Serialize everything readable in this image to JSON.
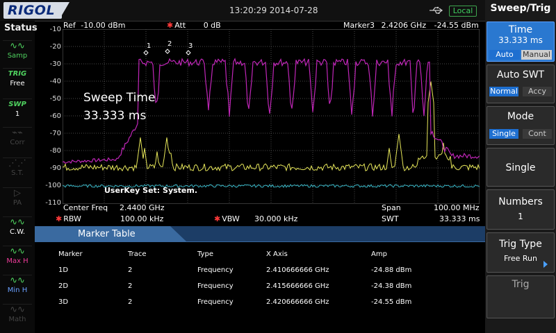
{
  "header": {
    "logo": "RIGOL",
    "datetime": "13:20:29 2014-07-28",
    "local_badge": "Local"
  },
  "status": {
    "title": "Status",
    "items": [
      {
        "icon": "wave-icon",
        "label": "Samp"
      },
      {
        "icon_text": "TRIG",
        "label": "Free"
      },
      {
        "icon_text": "SWP",
        "label": "1"
      },
      {
        "icon": "corr-icon",
        "label": "Corr"
      },
      {
        "icon": "st-icon",
        "label": "S.T."
      },
      {
        "icon": "pa-icon",
        "label": "PA"
      },
      {
        "icon": "wave-icon",
        "label": "C.W."
      },
      {
        "icon": "wave-icon",
        "label": "Max H"
      },
      {
        "icon": "wave-icon",
        "label": "Min H"
      },
      {
        "icon": "wave-icon",
        "label": "Math"
      }
    ]
  },
  "plot_header": {
    "ref_label": "Ref",
    "ref_value": "-10.00 dBm",
    "att_label": "Att",
    "att_value": "0 dB",
    "marker_label": "Marker3",
    "marker_freq": "2.4206 GHz",
    "marker_amp": "-24.55 dBm"
  },
  "y_axis": [
    "-10",
    "-20",
    "-30",
    "-40",
    "-50",
    "-60",
    "-70",
    "-80",
    "-90",
    "-100",
    "-110"
  ],
  "markers_on_plot": [
    "1",
    "2",
    "3"
  ],
  "overlay": {
    "sweep_time_label": "Sweep Time",
    "sweep_time_value": "33.333 ms",
    "userkey_text": "UserKey Set:  System."
  },
  "params": {
    "center_freq_label": "Center Freq",
    "center_freq_value": "2.4400 GHz",
    "span_label": "Span",
    "span_value": "100.00 MHz",
    "rbw_label": "RBW",
    "rbw_value": "100.00 kHz",
    "vbw_label": "VBW",
    "vbw_value": "30.000 kHz",
    "swt_label": "SWT",
    "swt_value": "33.333 ms"
  },
  "marker_table": {
    "title": "Marker Table",
    "columns": [
      "Marker",
      "Trace",
      "Type",
      "X Axis",
      "Amp"
    ],
    "rows": [
      [
        "1D",
        "2",
        "Frequency",
        "2.410666666 GHz",
        "-24.88 dBm"
      ],
      [
        "2D",
        "2",
        "Frequency",
        "2.415666666 GHz",
        "-24.38 dBm"
      ],
      [
        "3D",
        "2",
        "Frequency",
        "2.420666666 GHz",
        "-24.55 dBm"
      ]
    ]
  },
  "softkeys": {
    "menu_title": "Sweep/Trig",
    "time": {
      "label": "Time",
      "value": "33.333 ms",
      "opt_auto": "Auto",
      "opt_manual": "Manual"
    },
    "auto_swt": {
      "label": "Auto SWT",
      "opt_normal": "Normal",
      "opt_accy": "Accy"
    },
    "mode": {
      "label": "Mode",
      "opt_single": "Single",
      "opt_cont": "Cont"
    },
    "single": {
      "label": "Single"
    },
    "numbers": {
      "label": "Numbers",
      "value": "1"
    },
    "trig_type": {
      "label": "Trig Type",
      "value": "Free Run"
    },
    "trig_partial": {
      "label": "Trig"
    }
  },
  "colors": {
    "trace_magenta": "#c026b8",
    "trace_yellow": "#e8e85a",
    "trace_cyan": "#3ab8c8",
    "grid": "#5a5a5a",
    "accent_blue": "#2a78d0",
    "marker_star": "#ff3a3a"
  }
}
